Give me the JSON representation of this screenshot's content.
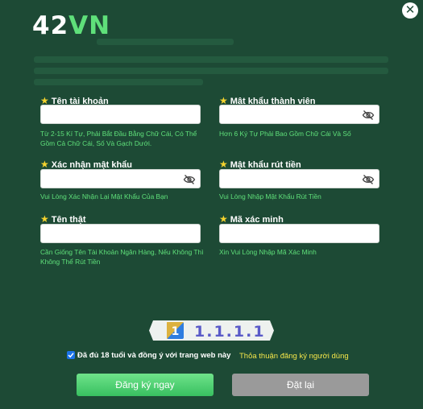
{
  "logo": {
    "part1": "42",
    "part2": "VN"
  },
  "close": {
    "symbol": "✕"
  },
  "fields": {
    "username": {
      "label": "Tên tài khoản",
      "hint": "Từ 2-15 Kí Tự, Phải Bắt Đầu Bằng Chữ Cái, Có Thể Gồm Cả Chữ Cái, Số Và Gạch Dưới.",
      "value": ""
    },
    "password": {
      "label": "Mật khẩu thành viên",
      "hint": "Hơn 6 Ký Tự Phải Bao Gồm Chữ Cái Và Số",
      "value": ""
    },
    "confirm_password": {
      "label": "Xác nhận mật khẩu",
      "hint": "Vui Lòng Xác Nhận Lại Mật Khẩu Của Bạn",
      "value": ""
    },
    "withdraw_password": {
      "label": "Mật khẩu rút tiền",
      "hint": "Vui Lòng Nhập Mật Khẩu Rút Tiền",
      "value": ""
    },
    "real_name": {
      "label": "Tên thật",
      "hint": "Cần Giống Tên Tài Khoản Ngân Hàng, Nếu Không Thì Không Thể Rút Tiền",
      "value": ""
    },
    "verify_code": {
      "label": "Mã xác minh",
      "hint": "Xin Vui Lòng Nhập Mã Xác Minh",
      "value": ""
    }
  },
  "captcha": {
    "text": "1.1.1.1",
    "badge": "1"
  },
  "agreement": {
    "text": "Đã đủ 18 tuổi và đồng ý với trang web này",
    "link": "Thỏa thuận đăng ký người dùng"
  },
  "buttons": {
    "register": "Đăng ký ngay",
    "reset": "Đặt lại"
  },
  "colors": {
    "background": "#1d4a35",
    "accent": "#5fe07a",
    "star": "#f5d32e",
    "link": "#f3e54a"
  }
}
